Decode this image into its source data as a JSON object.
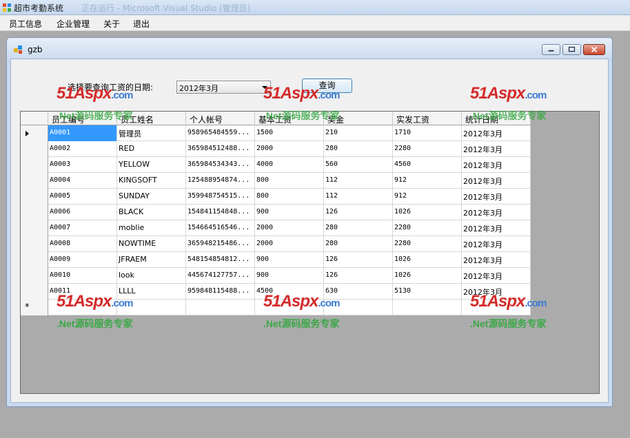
{
  "app": {
    "title": "超市考勤系统",
    "ghost_title": "正在运行 - Microsoft Visual Studio (管理员)"
  },
  "menu": [
    "员工信息",
    "企业管理",
    "关于",
    "退出"
  ],
  "child_window": {
    "title": "gzb"
  },
  "filter": {
    "label": "选择要查询工资的日期:",
    "selected_date": "2012年3月",
    "query_label": "查询"
  },
  "grid": {
    "columns": [
      "员工编号",
      "员工姓名",
      "个人帐号",
      "基本工资",
      "奖金",
      "实发工资",
      "统计日期"
    ],
    "rows": [
      [
        "A0001",
        "管理员",
        "958965484559...",
        "1500",
        "210",
        "1710",
        "2012年3月"
      ],
      [
        "A0002",
        "RED",
        "365984512488...",
        "2000",
        "280",
        "2280",
        "2012年3月"
      ],
      [
        "A0003",
        "YELLOW",
        "365984534343...",
        "4000",
        "560",
        "4560",
        "2012年3月"
      ],
      [
        "A0004",
        "KINGSOFT",
        "125488954874...",
        "800",
        "112",
        "912",
        "2012年3月"
      ],
      [
        "A0005",
        "SUNDAY",
        "359948754515...",
        "800",
        "112",
        "912",
        "2012年3月"
      ],
      [
        "A0006",
        "BLACK",
        "154841154848...",
        "900",
        "126",
        "1026",
        "2012年3月"
      ],
      [
        "A0007",
        "moblie",
        "154664516546...",
        "2000",
        "280",
        "2280",
        "2012年3月"
      ],
      [
        "A0008",
        "NOWTIME",
        "365948215486...",
        "2000",
        "280",
        "2280",
        "2012年3月"
      ],
      [
        "A0009",
        "JFRAEM",
        "548154854812...",
        "900",
        "126",
        "1026",
        "2012年3月"
      ],
      [
        "A0010",
        "look",
        "445674127757...",
        "900",
        "126",
        "1026",
        "2012年3月"
      ],
      [
        "A0011",
        "LLLL",
        "959848115488...",
        "4500",
        "630",
        "5130",
        "2012年3月"
      ]
    ],
    "new_row_marker": "*"
  },
  "watermark": {
    "brand": "51Aspx",
    "domain": ".com",
    "slogan": ".Net源码服务专家"
  },
  "colors": {
    "selection": "#3399ff",
    "watermark_red": "#d52a2a",
    "watermark_green": "#3aa846"
  }
}
